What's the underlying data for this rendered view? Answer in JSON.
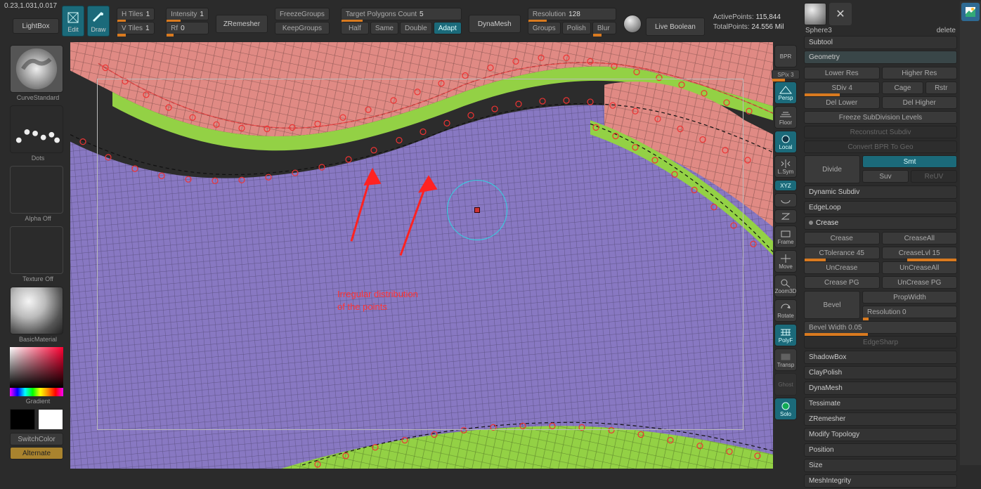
{
  "coords": "0.23,1.031,0.017",
  "shelf": {
    "lightbox": "LightBox",
    "edit": "Edit",
    "draw": "Draw",
    "htiles_label": "H Tiles",
    "htiles": "1",
    "vtiles_label": "V Tiles",
    "vtiles": "1",
    "intensity_label": "Intensity",
    "intensity": "1",
    "rf_label": "Rf",
    "rf": "0",
    "zremesher": "ZRemesher",
    "freeze": "FreezeGroups",
    "keep": "KeepGroups",
    "target_label": "Target Polygons Count",
    "target": "5",
    "half": "Half",
    "same": "Same",
    "double": "Double",
    "adapt": "Adapt",
    "dyna": "DynaMesh",
    "res_label": "Resolution",
    "res": "128",
    "groups": "Groups",
    "polish": "Polish",
    "blur_label": "Blur",
    "blur": "",
    "live": "Live Boolean"
  },
  "stats": {
    "ap_label": "ActivePoints:",
    "ap": "115,844",
    "tp_label": "TotalPoints:",
    "tp": "24.556 Mil"
  },
  "left": {
    "curve": "CurveStandard",
    "dots": "Dots",
    "alpha": "Alpha Off",
    "tex": "Texture Off",
    "mat": "BasicMaterial",
    "grad": "Gradient",
    "switch": "SwitchColor",
    "alt": "Alternate"
  },
  "right": {
    "bpr": "BPR",
    "spix_label": "SPix",
    "spix": "3",
    "persp": "Persp",
    "floor": "Floor",
    "local": "Local",
    "lsym": "L.Sym",
    "xyz": "XYZ",
    "frame": "Frame",
    "move": "Move",
    "zoom": "Zoom3D",
    "rotate": "Rotate",
    "polyf": "PolyF",
    "transp": "Transp",
    "ghost": "Ghost",
    "solo": "Solo"
  },
  "rpanel": {
    "sphere": "Sphere3",
    "del": "delete",
    "subtool": "Subtool",
    "geometry": "Geometry",
    "lower": "Lower Res",
    "higher": "Higher Res",
    "sdiv_label": "SDiv",
    "sdiv": "4",
    "cage": "Cage",
    "rstr": "Rstr",
    "dellower": "Del Lower",
    "delhigher": "Del Higher",
    "freeze": "Freeze SubDivision Levels",
    "reconstruct": "Reconstruct Subdiv",
    "convert": "Convert BPR To Geo",
    "divide": "Divide",
    "smt": "Smt",
    "suv": "Suv",
    "reuv": "ReUV",
    "dynsub": "Dynamic Subdiv",
    "edgeloop": "EdgeLoop",
    "crease_hdr": "Crease",
    "crease": "Crease",
    "creaseall": "CreaseAll",
    "ctol_label": "CTolerance",
    "ctol": "45",
    "clvl_label": "CreaseLvl",
    "clvl": "15",
    "uncrease": "UnCrease",
    "uncreaseall": "UnCreaseAll",
    "creasepg": "Crease PG",
    "uncreasepg": "UnCrease PG",
    "bevel": "Bevel",
    "propwidth": "PropWidth",
    "bres_label": "Resolution",
    "bres": "0",
    "bw_label": "Bevel Width",
    "bw": "0.05",
    "edgesharp": "EdgeSharp",
    "shadow": "ShadowBox",
    "clay": "ClayPolish",
    "dynamesh": "DynaMesh",
    "tess": "Tessimate",
    "zremesh": "ZRemesher",
    "modtopo": "Modify Topology",
    "position": "Position",
    "size": "Size",
    "meshint": "MeshIntegrity"
  },
  "annotation": {
    "line1": "Irregular distribution",
    "line2": "of the points"
  },
  "chart_data": {
    "type": "none"
  }
}
